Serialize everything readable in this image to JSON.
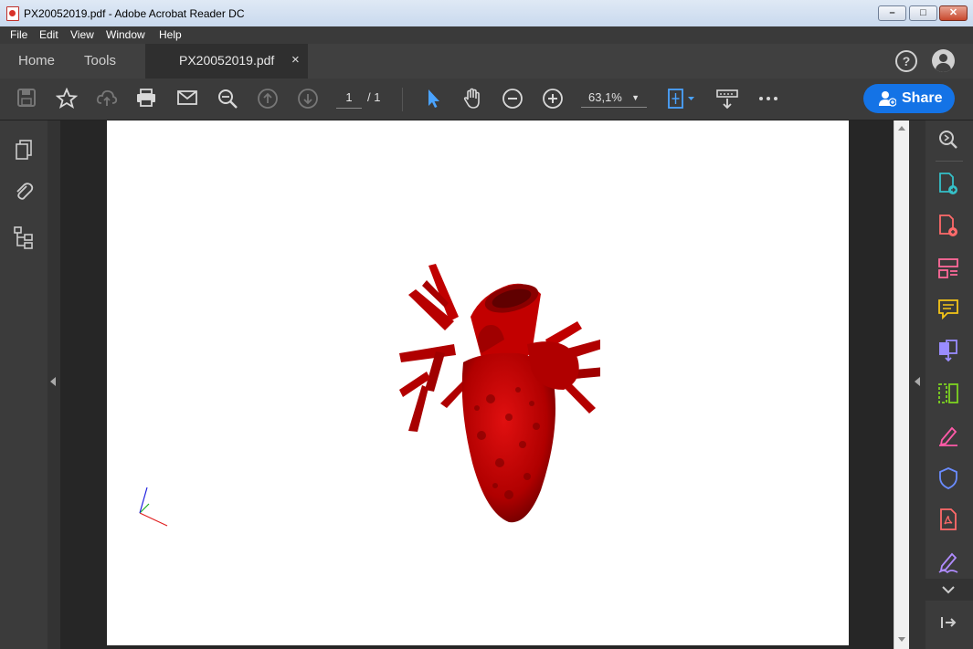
{
  "window": {
    "title": "PX20052019.pdf - Adobe Acrobat Reader DC",
    "minimize": "–",
    "maximize": "□",
    "close": "✕"
  },
  "menu": [
    "File",
    "Edit",
    "View",
    "Window",
    "Help"
  ],
  "tabs": {
    "home": "Home",
    "tools": "Tools",
    "document": "PX20052019.pdf",
    "close": "×"
  },
  "toolbar": {
    "current_page": "1",
    "page_total": "/ 1",
    "zoom": "63,1%",
    "share_label": "Share"
  },
  "icons": {
    "toolbar": [
      "save-icon",
      "bookmark-star-icon",
      "upload-cloud-icon",
      "print-icon",
      "mail-icon",
      "search-zoom-icon",
      "page-up-icon",
      "page-down-icon",
      "select-cursor-icon",
      "hand-pan-icon",
      "zoom-out-icon",
      "zoom-in-icon",
      "fit-page-icon",
      "scroll-mode-icon",
      "more-icon"
    ],
    "left_rail": [
      "page-thumbnails-icon",
      "attachments-icon",
      "model-tree-icon"
    ],
    "right_rail": [
      "search-sidebar-icon",
      "export-pdf-icon",
      "create-pdf-icon",
      "organize-pages-icon",
      "comment-icon",
      "combine-files-icon",
      "compress-icon",
      "fill-sign-icon",
      "protect-icon",
      "pdf-icon",
      "sign-icon",
      "expand-more-icon",
      "collapse-panel-icon"
    ]
  },
  "colors": {
    "accent": "#1473e6",
    "heart": "#c00000",
    "heart_dark": "#700000"
  }
}
